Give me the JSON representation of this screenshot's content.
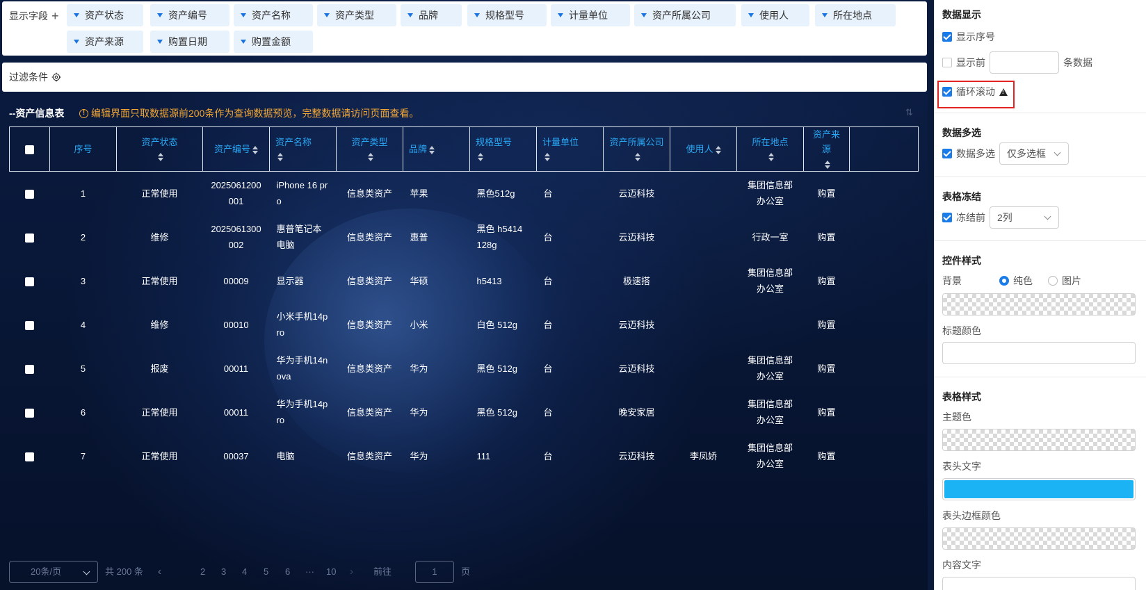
{
  "fields_bar": {
    "label": "显示字段",
    "chips": [
      "资产状态",
      "资产编号",
      "资产名称",
      "资产类型",
      "品牌",
      "规格型号",
      "计量单位",
      "资产所属公司",
      "使用人",
      "所在地点",
      "资产来源",
      "购置日期",
      "购置金额"
    ]
  },
  "filter_bar": {
    "label": "过滤条件"
  },
  "table": {
    "title": "--资产信息表",
    "notice": "编辑界面只取数据源前200条作为查询数据预览，完整数据请访问页面查看。",
    "headers": [
      "序号",
      "资产状态",
      "资产编号",
      "资产名称",
      "资产类型",
      "品牌",
      "规格型号",
      "计量单位",
      "资产所属公司",
      "使用人",
      "所在地点",
      "资产来源"
    ],
    "rows": [
      [
        "1",
        "正常使用",
        "2025061200001",
        "iPhone 16 pro",
        "信息类资产",
        "苹果",
        "黑色512g",
        "台",
        "云迈科技",
        "",
        "集团信息部办公室",
        "购置"
      ],
      [
        "2",
        "维修",
        "2025061300002",
        "惠普笔记本电脑",
        "信息类资产",
        "惠普",
        "黑色 h5414 128g",
        "台",
        "云迈科技",
        "",
        "行政一室",
        "购置"
      ],
      [
        "3",
        "正常使用",
        "00009",
        "显示器",
        "信息类资产",
        "华硕",
        "h5413",
        "台",
        "极速搭",
        "",
        "集团信息部办公室",
        "购置"
      ],
      [
        "4",
        "维修",
        "00010",
        "小米手机14pro",
        "信息类资产",
        "小米",
        "白色 512g",
        "台",
        "云迈科技",
        "",
        "",
        "购置"
      ],
      [
        "5",
        "报废",
        "00011",
        "华为手机14nova",
        "信息类资产",
        "华为",
        "黑色 512g",
        "台",
        "云迈科技",
        "",
        "集团信息部办公室",
        "购置"
      ],
      [
        "6",
        "正常使用",
        "00011",
        "华为手机14pro",
        "信息类资产",
        "华为",
        "黑色 512g",
        "台",
        "晚安家居",
        "",
        "集团信息部办公室",
        "购置"
      ],
      [
        "7",
        "正常使用",
        "00037",
        "电脑",
        "信息类资产",
        "华为",
        "111",
        "台",
        "云迈科技",
        "李凤娇",
        "集团信息部办公室",
        "购置"
      ]
    ]
  },
  "pagination": {
    "page_size": "20条/页",
    "total": "共 200 条",
    "pages": [
      "2",
      "3",
      "4",
      "5",
      "6",
      "···",
      "10"
    ],
    "goto_label": "前往",
    "goto_value": "1",
    "page_suffix": "页"
  },
  "panel": {
    "data_display": {
      "title": "数据显示",
      "show_index": "显示序号",
      "show_first_prefix": "显示前",
      "show_first_suffix": "条数据",
      "loop_scroll": "循环滚动"
    },
    "multi_select": {
      "title": "数据多选",
      "label": "数据多选",
      "mode": "仅多选框"
    },
    "freeze": {
      "title": "表格冻结",
      "label": "冻结前",
      "value": "2列"
    },
    "widget_style": {
      "title": "控件样式",
      "background_label": "背景",
      "solid_label": "纯色",
      "image_label": "图片",
      "title_color_label": "标题颜色"
    },
    "table_style": {
      "title": "表格样式",
      "theme_color_label": "主题色",
      "header_text_label": "表头文字",
      "header_text_color": "#1bb3f3",
      "header_border_label": "表头边框颜色",
      "content_text_label": "内容文字"
    }
  }
}
